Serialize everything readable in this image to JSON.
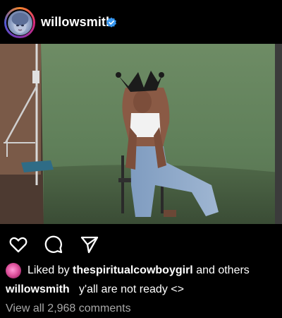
{
  "post": {
    "username": "willowsmith",
    "avatar_icon": "profile-avatar",
    "verified_icon": "verified-badge-icon",
    "accent_color": "#3897f0"
  },
  "actions": {
    "like_icon": "heart-icon",
    "comment_icon": "comment-icon",
    "share_icon": "send-icon"
  },
  "likes": {
    "prefix": "Liked by",
    "user": "thespiritualcowboygirl",
    "suffix": "and others"
  },
  "caption": {
    "username": "willowsmith",
    "text": "y'all are not ready <>"
  },
  "comments": {
    "view_all": "View all 2,968 comments"
  }
}
